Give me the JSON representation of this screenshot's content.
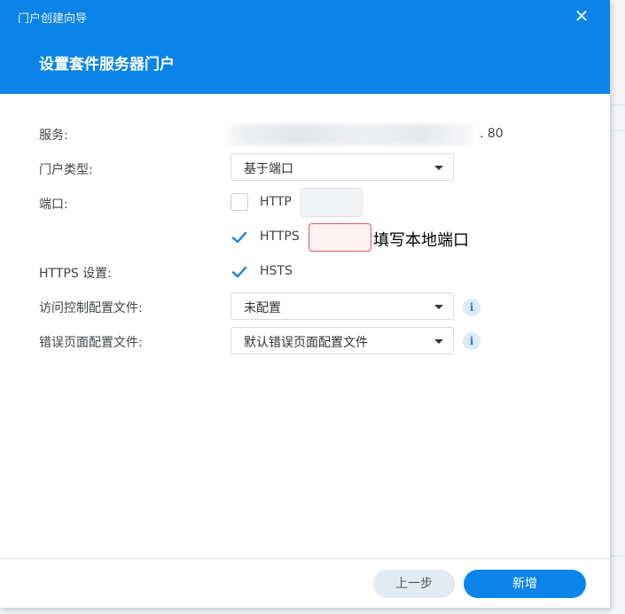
{
  "dialog": {
    "wizard_title": "门户创建向导",
    "close_icon": "close-icon",
    "step_title": "设置套件服务器门户"
  },
  "form": {
    "service": {
      "label": "服务:",
      "port_suffix": ". 80"
    },
    "portal_type": {
      "label": "门户类型:",
      "value": "基于端口"
    },
    "port": {
      "label": "端口:",
      "http": {
        "label": "HTTP",
        "checked": false,
        "value": ""
      },
      "https": {
        "label": "HTTPS",
        "checked": true,
        "value": ""
      }
    },
    "https_settings": {
      "label": "HTTPS 设置:",
      "hsts_label": "HSTS",
      "hsts_checked": true
    },
    "access_control": {
      "label": "访问控制配置文件:",
      "value": "未配置"
    },
    "error_page": {
      "label": "错误页面配置文件:",
      "value": "默认错误页面配置文件"
    }
  },
  "annotation": "填写本地端口",
  "footer": {
    "prev_label": "上一步",
    "add_label": "新增"
  },
  "colors": {
    "accent": "#0a84e8",
    "error_border": "#e25a5a"
  }
}
